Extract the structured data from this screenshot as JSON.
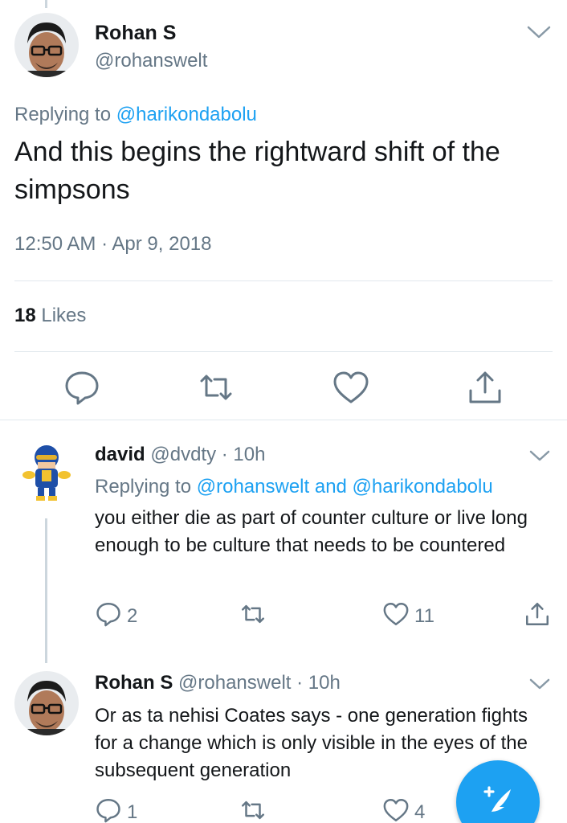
{
  "main_tweet": {
    "author_name": "Rohan S",
    "author_handle": "@rohanswelt",
    "replying_prefix": "Replying to",
    "replying_to": "@harikondabolu",
    "text": "And this begins the rightward shift of the simpsons",
    "timestamp": "12:50 AM · Apr 9, 2018",
    "likes_count": "18",
    "likes_label": "Likes",
    "actions": [
      "reply-icon",
      "retweet-icon",
      "like-icon",
      "share-icon"
    ]
  },
  "replies": [
    {
      "name": "david",
      "handle": "@dvdty",
      "time": "· 10h",
      "replying_prefix": "Replying to",
      "replying_to": "@rohanswelt and @harikondabolu",
      "text": "you either die as part of counter culture or live long enough to be culture that needs to be countered",
      "reply_count": "2",
      "retweet_count": "",
      "like_count": "11"
    },
    {
      "name": "Rohan S",
      "handle": "@rohanswelt",
      "time": "· 10h",
      "text": "Or as ta nehisi Coates says - one generation fights for a change which is only visible in the eyes of the subsequent generation",
      "reply_count": "1",
      "retweet_count": "",
      "like_count": "4"
    }
  ],
  "colors": {
    "accent": "#1da1f2",
    "text_primary": "#14171a",
    "text_secondary": "#657786",
    "divider": "#e1e8ed"
  },
  "fab_icon": "compose-tweet-icon"
}
